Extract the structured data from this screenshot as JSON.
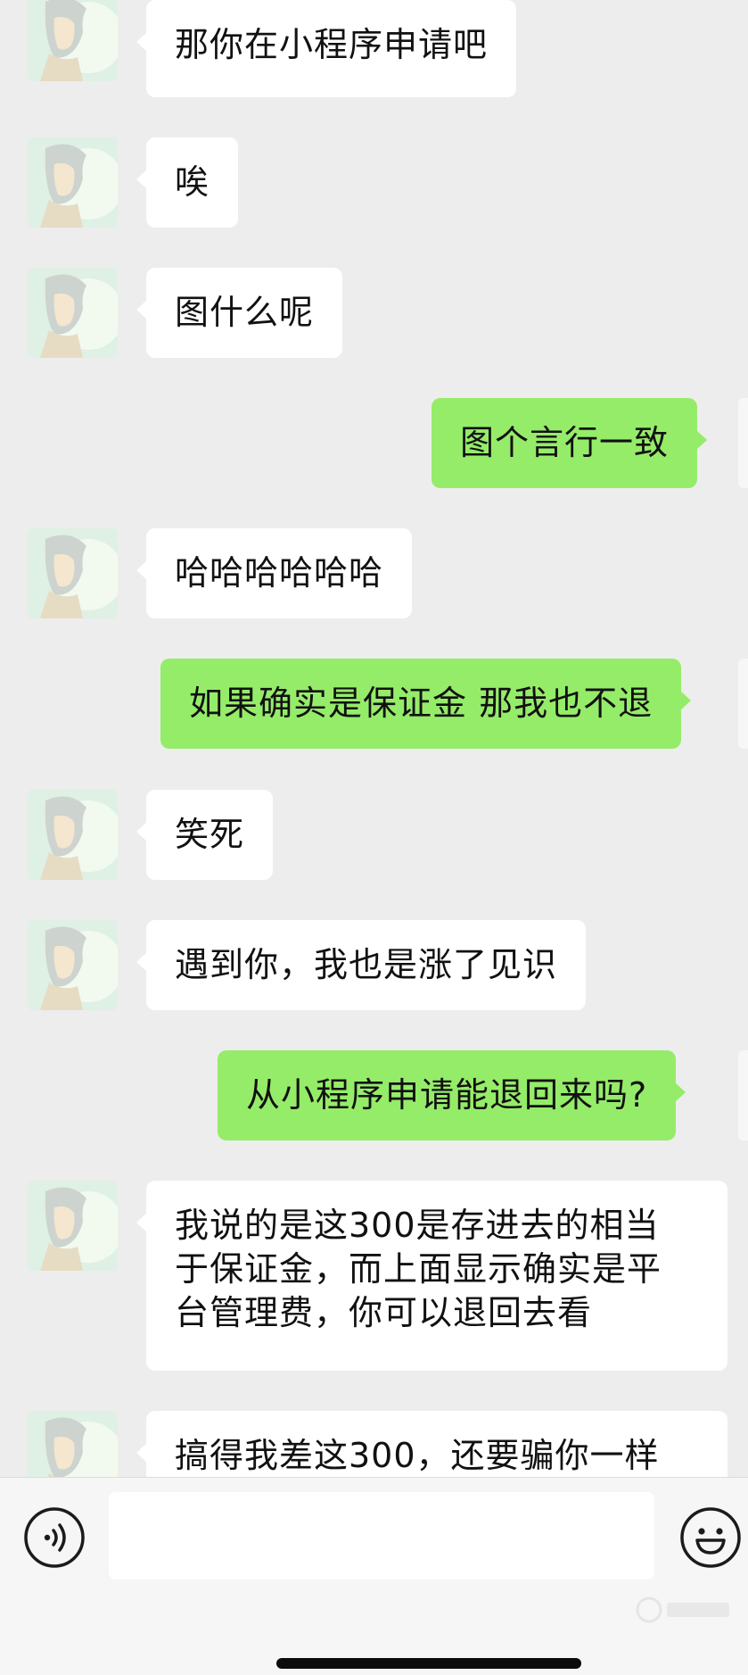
{
  "messages": [
    {
      "side": "in",
      "text": "那你在小程序申请吧"
    },
    {
      "side": "in",
      "text": "唉"
    },
    {
      "side": "in",
      "text": "图什么呢"
    },
    {
      "side": "out",
      "text": "图个言行一致"
    },
    {
      "side": "in",
      "text": "哈哈哈哈哈哈"
    },
    {
      "side": "out",
      "text": "如果确实是保证金 那我也不退"
    },
    {
      "side": "in",
      "text": "笑死"
    },
    {
      "side": "in",
      "text": "遇到你，我也是涨了见识"
    },
    {
      "side": "out",
      "text": "从小程序申请能退回来吗?"
    },
    {
      "side": "in",
      "text": "我说的是这300是存进去的相当\n于保证金，而上面显示确实是平\n台管理费，你可以退回去看"
    },
    {
      "side": "in",
      "text": "搞得我差这300，还要骗你一样"
    }
  ],
  "input_bar": {
    "placeholder": "",
    "voice_icon": "voice-icon",
    "emoji_icon": "emoji-icon"
  },
  "colors": {
    "background": "#ededed",
    "bubble_in": "#ffffff",
    "bubble_out": "#95ec69",
    "text": "#111111"
  }
}
